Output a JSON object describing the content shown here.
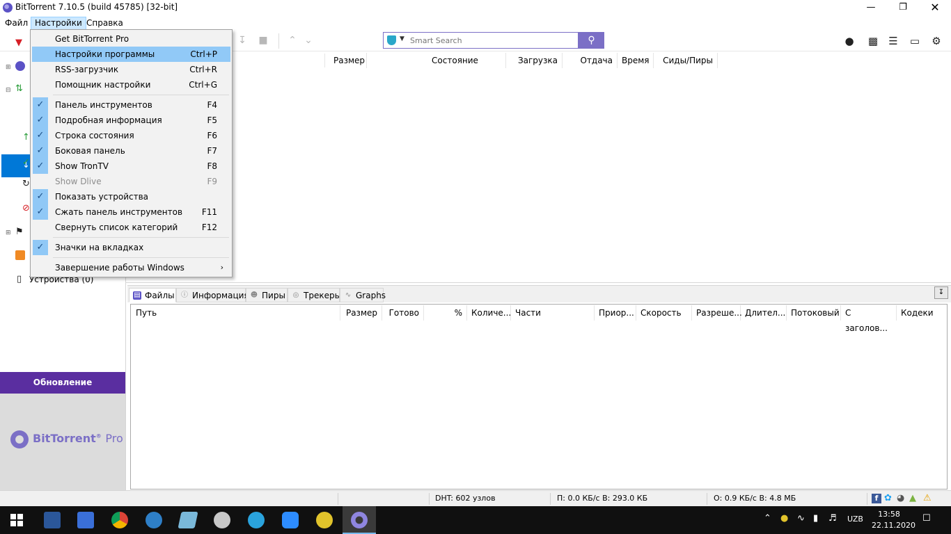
{
  "window": {
    "title": "BitTorrent 7.10.5  (build 45785) [32-bit]"
  },
  "menubar": {
    "file": "Файл",
    "settings": "Настройки",
    "help": "Справка"
  },
  "search": {
    "placeholder": "Smart Search"
  },
  "torrent_list": {
    "columns": [
      "Размер",
      "Состояние",
      "Загрузка",
      "Отдача",
      "Время",
      "Сиды/Пиры"
    ]
  },
  "sidebar": {
    "devices_label": "Устройства (0)",
    "update_button": "Обновление",
    "promo_brand": "BitTorrent",
    "promo_suffix": "Pro",
    "promo_reg": "®"
  },
  "settings_menu": {
    "items": [
      {
        "label": "Get BitTorrent Pro",
        "shortcut": "",
        "checked": false
      },
      {
        "label": "Настройки программы",
        "shortcut": "Ctrl+P",
        "checked": false,
        "highlighted": true
      },
      {
        "label": "RSS-загрузчик",
        "shortcut": "Ctrl+R",
        "checked": false
      },
      {
        "label": "Помощник настройки",
        "shortcut": "Ctrl+G",
        "checked": false
      },
      {
        "label": "Панель инструментов",
        "shortcut": "F4",
        "checked": true
      },
      {
        "label": "Подробная информация",
        "shortcut": "F5",
        "checked": true
      },
      {
        "label": "Строка состояния",
        "shortcut": "F6",
        "checked": true
      },
      {
        "label": "Боковая панель",
        "shortcut": "F7",
        "checked": true
      },
      {
        "label": "Show TronTV",
        "shortcut": "F8",
        "checked": true
      },
      {
        "label": "Show Dlive",
        "shortcut": "F9",
        "checked": false,
        "disabled": true
      },
      {
        "label": "Показать устройства",
        "shortcut": "",
        "checked": true
      },
      {
        "label": "Сжать панель инструментов",
        "shortcut": "F11",
        "checked": true
      },
      {
        "label": "Свернуть список категорий",
        "shortcut": "F12",
        "checked": false
      },
      {
        "label": "Значки на вкладках",
        "shortcut": "",
        "checked": true
      },
      {
        "label": "Завершение работы Windows",
        "shortcut": "",
        "checked": false,
        "submenu": true
      }
    ]
  },
  "detail_tabs": [
    "Файлы",
    "Информация",
    "Пиры",
    "Трекеры",
    "Graphs"
  ],
  "files_columns": [
    "Путь",
    "Размер",
    "Готово",
    "%",
    "Количе...",
    "Части",
    "Приор...",
    "Скорость",
    "Разреше...",
    "Длител...",
    "Потоковый",
    "С заголов...",
    "Кодеки"
  ],
  "statusbar": {
    "dht": "DHT: 602 узлов",
    "download": "П: 0.0 КБ/с В: 293.0 КБ",
    "upload": "О: 0.9 КБ/с В: 4.8 МБ"
  },
  "taskbar": {
    "language": "UZB",
    "time": "13:58",
    "date": "22.11.2020"
  }
}
